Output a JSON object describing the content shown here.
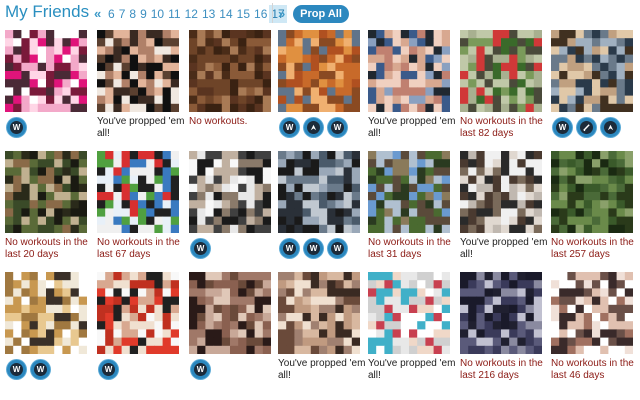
{
  "header": {
    "title": "My Friends",
    "prev_arrow": "«",
    "next_arrow": "»",
    "pages": [
      "6",
      "7",
      "8",
      "9",
      "10",
      "11",
      "12",
      "13",
      "14",
      "15",
      "16",
      "17"
    ],
    "current_page": "17",
    "prop_all_label": "Prop All"
  },
  "colors": {
    "accent": "#2c88bf",
    "title": "#2a8fc0",
    "warning_text": "#8b1a14"
  },
  "friends": [
    {
      "palette": [
        "#e0147a",
        "#f3a9c9",
        "#ffffff",
        "#7a1a3a",
        "#ffd6e6",
        "#4a2a36"
      ],
      "caption": "",
      "caption_style": "",
      "badges": [
        "workout-w-icon"
      ]
    },
    {
      "palette": [
        "#101010",
        "#3a2a22",
        "#b08068",
        "#e2b49a",
        "#5a4030",
        "#f0e8e0"
      ],
      "caption": "You've propped 'em all!",
      "caption_style": "black",
      "badges": []
    },
    {
      "palette": [
        "#5a3420",
        "#8a5a38",
        "#3a2212",
        "#a87a55",
        "#6e4428",
        "#4a2c18"
      ],
      "caption": "No workouts.",
      "caption_style": "red",
      "badges": []
    },
    {
      "palette": [
        "#c86a2a",
        "#8a4a22",
        "#e09040",
        "#b05020",
        "#60748a",
        "#f0b070"
      ],
      "caption": "",
      "caption_style": "",
      "badges": [
        "workout-w-icon",
        "run-icon",
        "workout-w-icon"
      ]
    },
    {
      "palette": [
        "#3a5a8a",
        "#d8a890",
        "#f0d0c0",
        "#202830",
        "#8aa0c0",
        "#c08070"
      ],
      "caption": "You've propped 'em all!",
      "caption_style": "black",
      "badges": []
    },
    {
      "palette": [
        "#3a6a2a",
        "#7a9a5a",
        "#c0c8a8",
        "#d03838",
        "#4a4a3a",
        "#a8b090"
      ],
      "caption": "No workouts in the last 82 days",
      "caption_style": "red",
      "badges": []
    },
    {
      "palette": [
        "#2a3a4a",
        "#c0a080",
        "#e0c8a8",
        "#6a7a8a",
        "#403020",
        "#a0b0c0"
      ],
      "caption": "",
      "caption_style": "",
      "badges": [
        "workout-w-icon",
        "pencil-icon",
        "run-icon"
      ]
    },
    {
      "palette": [
        "#3a4a28",
        "#1a1a12",
        "#8a6a48",
        "#5a6a38",
        "#c0b090",
        "#2a2a1a"
      ],
      "caption": "No workouts in the last 20 days",
      "caption_style": "red",
      "badges": []
    },
    {
      "palette": [
        "#e8f0f8",
        "#d83030",
        "#3a7ac0",
        "#f0f0f0",
        "#202020",
        "#50a040"
      ],
      "caption": "No workouts in the last 67 days",
      "caption_style": "red",
      "badges": []
    },
    {
      "palette": [
        "#e8e8e8",
        "#404040",
        "#8a7a6a",
        "#1a1a1a",
        "#c0b0a0",
        "#f8f8f8"
      ],
      "caption": "",
      "caption_style": "",
      "badges": [
        "workout-w-icon"
      ]
    },
    {
      "palette": [
        "#1a1a1a",
        "#4a5a6a",
        "#c0c8d0",
        "#6a7a8a",
        "#2a3038",
        "#9aa8b8"
      ],
      "caption": "",
      "caption_style": "",
      "badges": [
        "workout-w-icon",
        "workout-w-icon",
        "workout-w-icon"
      ]
    },
    {
      "palette": [
        "#6a9ad0",
        "#4a6a30",
        "#8a7a5a",
        "#2a3a20",
        "#b0c0d0",
        "#5a4a3a"
      ],
      "caption": "No workouts in the last 31 days",
      "caption_style": "red",
      "badges": []
    },
    {
      "palette": [
        "#f0f0f0",
        "#2a2a2a",
        "#c0b8b0",
        "#7a6a5a",
        "#e0d8d0",
        "#4a3a30"
      ],
      "caption": "You've propped 'em all!",
      "caption_style": "black",
      "badges": []
    },
    {
      "palette": [
        "#3a5a2a",
        "#6a8a4a",
        "#2a3a1a",
        "#8aa06a",
        "#4a6a38",
        "#1a2a12"
      ],
      "caption": "No workouts in the last 257 days",
      "caption_style": "red",
      "badges": []
    },
    {
      "palette": [
        "#ffffff",
        "#f0e8d8",
        "#c89850",
        "#3a3028",
        "#e8c890",
        "#a07840"
      ],
      "caption": "",
      "caption_style": "",
      "badges": [
        "workout-w-icon",
        "workout-w-icon"
      ]
    },
    {
      "palette": [
        "#e03a2a",
        "#f0e0d0",
        "#202020",
        "#c03020",
        "#f8f8f8",
        "#d8a890"
      ],
      "caption": "",
      "caption_style": "",
      "badges": [
        "workout-w-icon"
      ]
    },
    {
      "palette": [
        "#c8a898",
        "#a07868",
        "#6a4a3a",
        "#2a1a18",
        "#e0c8b8",
        "#8a6050"
      ],
      "caption": "",
      "caption_style": "",
      "badges": [
        "workout-w-icon"
      ]
    },
    {
      "palette": [
        "#d8b8a0",
        "#3a2a22",
        "#a08070",
        "#f0e0d0",
        "#6a4a3a",
        "#c09a80"
      ],
      "caption": "You've propped 'em all!",
      "caption_style": "black",
      "badges": []
    },
    {
      "palette": [
        "#ffffff",
        "#40b0c8",
        "#e8e8e8",
        "#c84050",
        "#f0d8c8",
        "#d0d0d0"
      ],
      "caption": "You've propped 'em all!",
      "caption_style": "black",
      "badges": []
    },
    {
      "palette": [
        "#1a1a2a",
        "#3a3a5a",
        "#8a8aa0",
        "#202030",
        "#5a5a7a",
        "#c0c0d0"
      ],
      "caption": "No workouts in the last 216 days",
      "caption_style": "red",
      "badges": []
    },
    {
      "palette": [
        "#f0e0d8",
        "#a07060",
        "#3a2a2a",
        "#e0c0b0",
        "#6a5048",
        "#ffffff"
      ],
      "caption": "No workouts in the last 46 days",
      "caption_style": "red",
      "badges": []
    }
  ]
}
